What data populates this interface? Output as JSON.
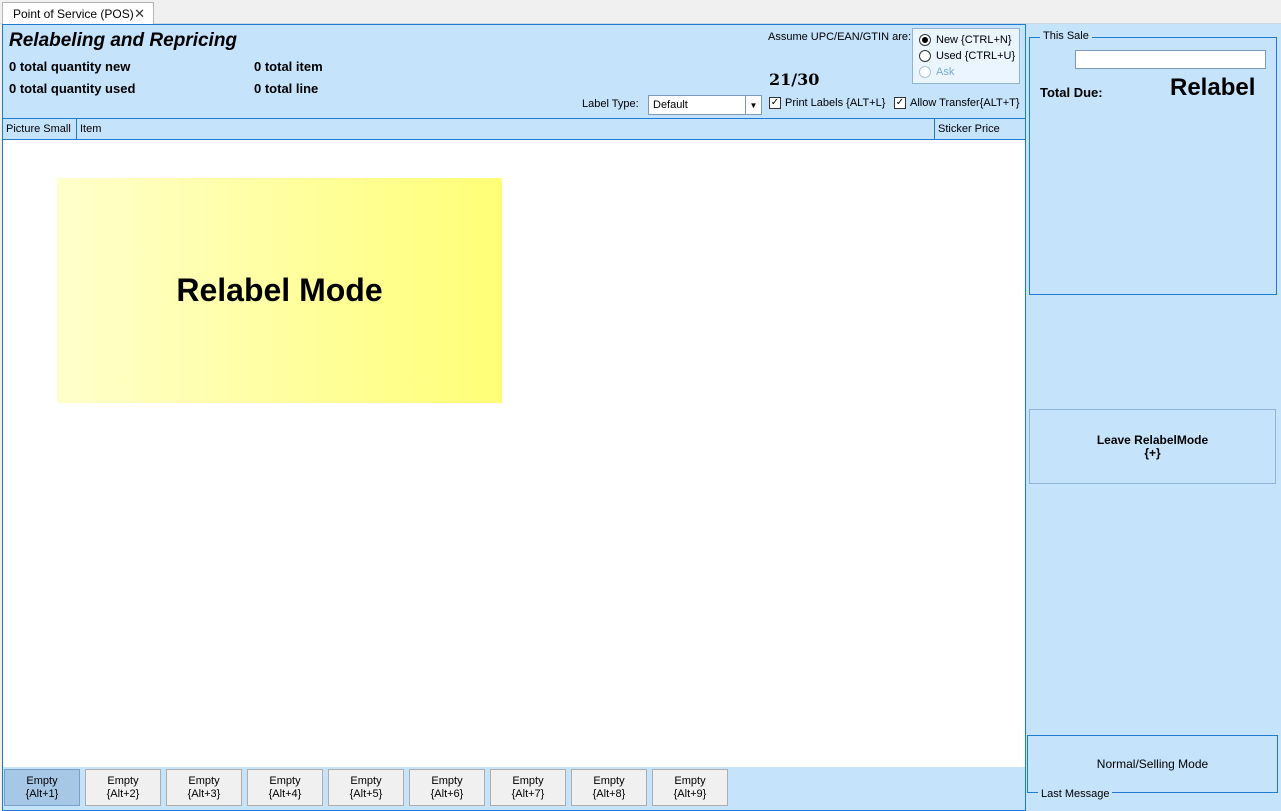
{
  "tab": {
    "title": "Point of Service (POS)",
    "close_glyph": "✕"
  },
  "header": {
    "title": "Relabeling and Repricing",
    "qty_new": "0 total quantity new",
    "qty_used": "0 total quantity used",
    "total_item": "0 total item",
    "total_line": "0 total line",
    "assume_label": "Assume UPC/EAN/GTIN are:",
    "counter": "21/30",
    "radios": [
      {
        "label": "New {CTRL+N}",
        "selected": true,
        "enabled": true
      },
      {
        "label": "Used {CTRL+U}",
        "selected": false,
        "enabled": true
      },
      {
        "label": "Ask",
        "selected": false,
        "enabled": false
      }
    ],
    "label_type_label": "Label Type:",
    "label_type_value": "Default",
    "print_labels": "Print Labels {ALT+L}",
    "allow_transfer": "Allow Transfer{ALT+T}"
  },
  "grid": {
    "columns": [
      "Picture Small",
      "Item",
      "Sticker Price"
    ],
    "banner": "Relabel Mode"
  },
  "slots": [
    {
      "label": "Empty",
      "key": "{Alt+1}"
    },
    {
      "label": "Empty",
      "key": "{Alt+2}"
    },
    {
      "label": "Empty",
      "key": "{Alt+3}"
    },
    {
      "label": "Empty",
      "key": "{Alt+4}"
    },
    {
      "label": "Empty",
      "key": "{Alt+5}"
    },
    {
      "label": "Empty",
      "key": "{Alt+6}"
    },
    {
      "label": "Empty",
      "key": "{Alt+7}"
    },
    {
      "label": "Empty",
      "key": "{Alt+8}"
    },
    {
      "label": "Empty",
      "key": "{Alt+9}"
    }
  ],
  "right": {
    "this_sale": "This Sale",
    "sale_input_value": "",
    "total_due": "Total Due:",
    "mode": "Relabel",
    "leave_line1": "Leave RelabelMode",
    "leave_line2": "{+}",
    "last_message_text": "Normal/Selling Mode",
    "last_message_label": "Last Message"
  },
  "colors": {
    "panel": "#c5e3fb",
    "border": "#1e7bd1",
    "banner_from": "#ffffcc",
    "banner_to": "#ffff77"
  }
}
